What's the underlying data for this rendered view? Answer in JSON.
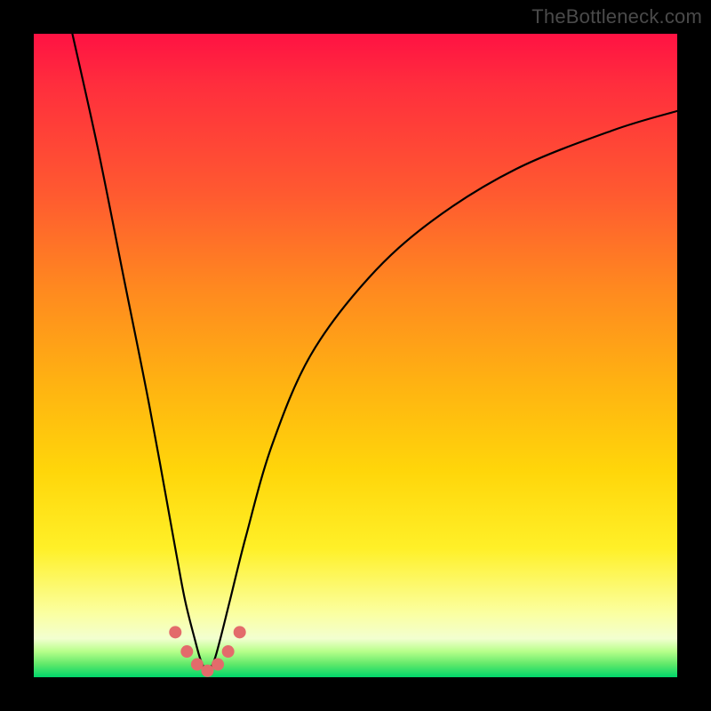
{
  "watermark": "TheBottleneck.com",
  "colors": {
    "frame": "#000000",
    "gradient_stops": [
      "#ff1243",
      "#ff2e3d",
      "#ff5a30",
      "#ff8a1f",
      "#ffb411",
      "#ffd60a",
      "#fff028",
      "#fbffa0",
      "#f2ffd0",
      "#b7ff8a",
      "#5fe86a",
      "#00d66a"
    ],
    "curve": "#000000",
    "dots": "#e36b6b"
  },
  "chart_data": {
    "type": "line",
    "title": "",
    "xlabel": "",
    "ylabel": "",
    "xlim": [
      0,
      100
    ],
    "ylim": [
      0,
      100
    ],
    "note": "Axes are unlabeled in the image. Values are 0–100 percent of the plot area, origin at bottom-left. Curve is a V-shaped bottleneck curve reaching ~0 at x≈27, with highlighted dots near the minimum.",
    "series": [
      {
        "name": "bottleneck-curve",
        "x": [
          6,
          10,
          14,
          18,
          22,
          23.5,
          25,
          26,
          27,
          28,
          29,
          30.5,
          33,
          37,
          43,
          52,
          62,
          75,
          90,
          100
        ],
        "y": [
          100,
          82,
          62,
          42,
          20,
          12,
          6,
          2.5,
          1,
          2.5,
          6,
          12,
          22,
          36,
          50,
          62,
          71,
          79,
          85,
          88
        ]
      },
      {
        "name": "highlight-dots",
        "x": [
          22,
          23.8,
          25.4,
          27,
          28.6,
          30.2,
          32
        ],
        "y": [
          7,
          4,
          2,
          1,
          2,
          4,
          7
        ]
      }
    ]
  }
}
